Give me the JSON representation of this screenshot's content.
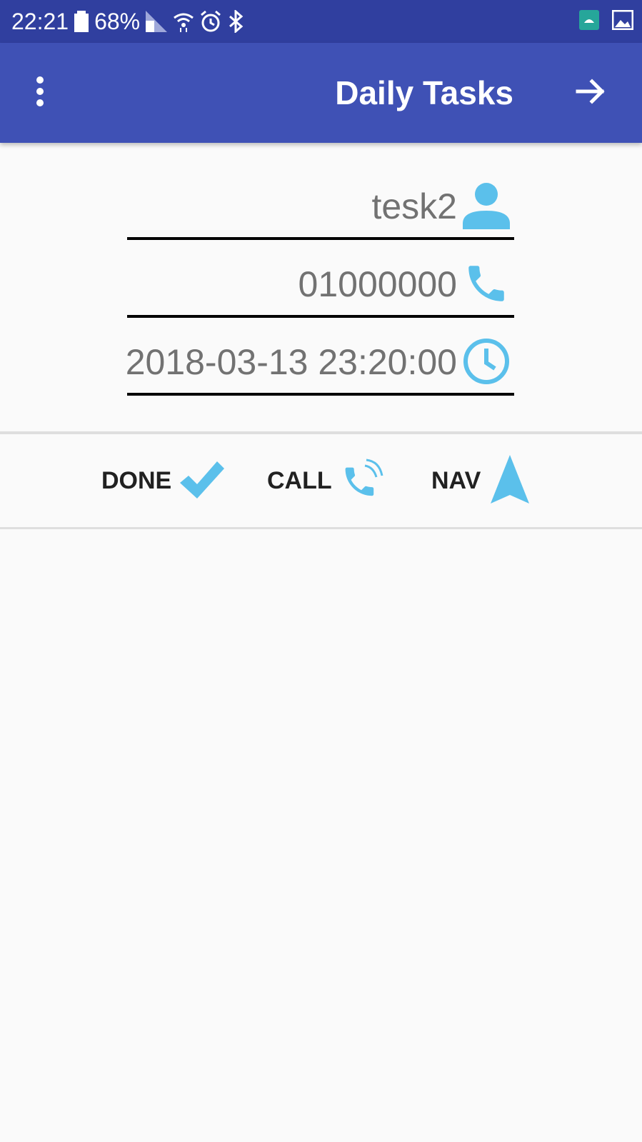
{
  "status_bar": {
    "time": "22:21",
    "battery": "68%",
    "icons": [
      "battery-icon",
      "signal-icon",
      "wifi-icon",
      "alarm-icon",
      "bluetooth-icon",
      "android-icon",
      "gallery-icon"
    ]
  },
  "app_bar": {
    "title": "Daily Tasks",
    "menu_icon": "overflow-menu-icon",
    "forward_icon": "arrow-forward-icon",
    "color": "#3f51b5"
  },
  "task": {
    "name": "tesk2",
    "phone": "01000000",
    "datetime": "2018-03-13 23:20:00"
  },
  "actions": {
    "done_label": "DONE",
    "call_label": "CALL",
    "nav_label": "NAV"
  },
  "colors": {
    "accent": "#5bc0eb",
    "status_bar": "#303f9f"
  }
}
